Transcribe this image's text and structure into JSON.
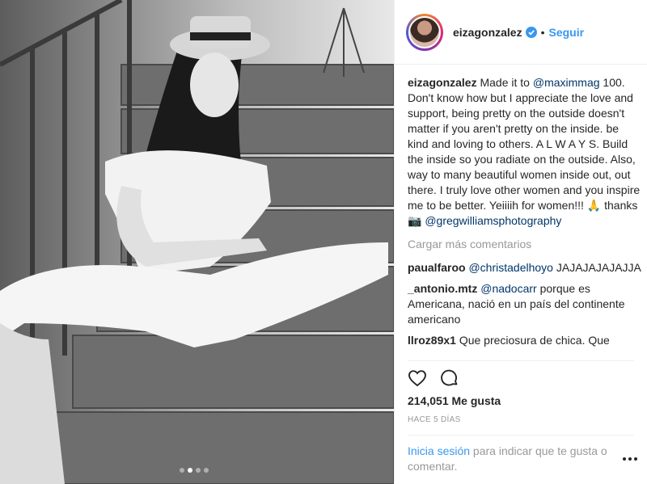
{
  "post": {
    "username": "eizagonzalez",
    "follow_label": "Seguir",
    "separator": "•",
    "carousel_dots": 4,
    "active_dot": 1
  },
  "caption": {
    "username": "eizagonzalez",
    "text_before": "Made it to ",
    "mention1": "@maximmag",
    "text_middle": " 100. Don't know how but I appreciate the love and support, being pretty on the outside doesn't matter if you aren't pretty on the inside. be kind and loving to others. A L W A Y S. Build the inside so you radiate on the outside. Also, way to many beautiful women inside out, out there. I truly love other women and you inspire me to be better. Yeiiiih for women!!! 🙏 thanks 📷 ",
    "mention2": "@gregwilliamsphotography"
  },
  "load_more": "Cargar más comentarios",
  "comments": [
    {
      "user": "paualfaroo",
      "mention": "@christadelhoyo",
      "text": " JAJAJAJAJAJJA"
    },
    {
      "user": "_antonio.mtz",
      "mention": "@nadocarr",
      "text": " porque es Americana, nació en un país del continente americano"
    },
    {
      "user": "llroz89x1",
      "mention": "",
      "text": " Que preciosura de chica. Que"
    }
  ],
  "likes": "214,051 Me gusta",
  "time": "Hace 5 días",
  "login": {
    "link": "Inicia sesión",
    "text": " para indicar que te gusta o comentar."
  },
  "colors": {
    "link": "#3897f0",
    "mention": "#003569",
    "muted": "#999999",
    "text": "#262626"
  },
  "icons": [
    "verified-badge-icon",
    "heart-icon",
    "comment-icon",
    "more-options-icon"
  ]
}
